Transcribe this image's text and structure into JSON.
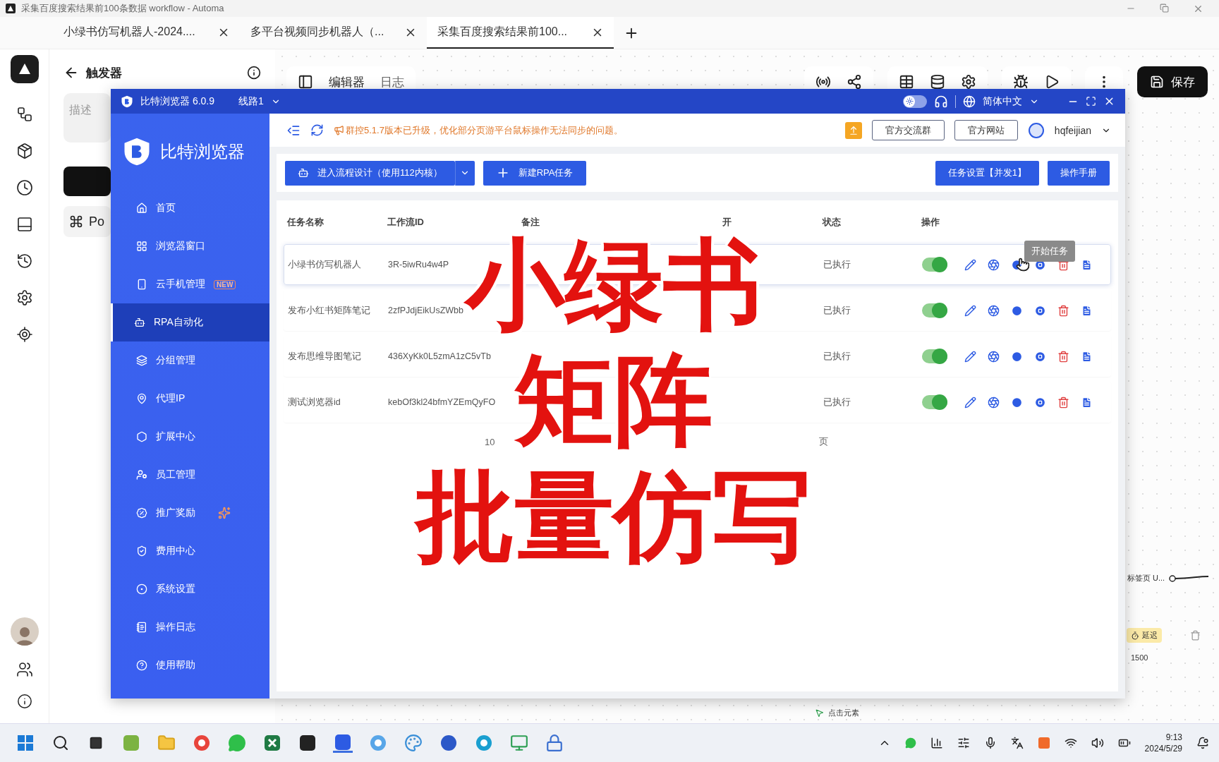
{
  "window": {
    "title": "采集百度搜索结果前100条数据 workflow - Automa"
  },
  "tabs": [
    {
      "label": "小绿书仿写机器人-2024....",
      "selected": false
    },
    {
      "label": "多平台视频同步机器人（...",
      "selected": false
    },
    {
      "label": "采集百度搜索结果前100...",
      "selected": true
    }
  ],
  "editor": {
    "back_label": "触发器",
    "description_placeholder": "描述",
    "side_item": "Po",
    "view_tabs": [
      {
        "label": "编辑器",
        "selected": true
      },
      {
        "label": "日志",
        "selected": false
      }
    ],
    "save_button": "保存"
  },
  "bit_browser": {
    "title": "比特浏览器 6.0.9",
    "route": "线路1",
    "dark_mode": false,
    "language": "简体中文",
    "brand": "比特浏览器",
    "nav": [
      {
        "label": "首页",
        "selected": false
      },
      {
        "label": "浏览器窗口",
        "selected": false
      },
      {
        "label": "云手机管理",
        "badge": "NEW",
        "selected": false
      },
      {
        "label": "RPA自动化",
        "selected": true
      },
      {
        "label": "分组管理",
        "selected": false
      },
      {
        "label": "代理IP",
        "selected": false
      },
      {
        "label": "扩展中心",
        "selected": false
      },
      {
        "label": "员工管理",
        "selected": false
      },
      {
        "label": "推广奖励",
        "selected": false
      },
      {
        "label": "费用中心",
        "selected": false
      },
      {
        "label": "系统设置",
        "selected": false
      },
      {
        "label": "操作日志",
        "selected": false
      },
      {
        "label": "使用帮助",
        "selected": false
      }
    ],
    "notice": "群控5.1.7版本已升级，优化部分页游平台鼠标操作无法同步的问题。",
    "top_buttons": [
      "官方交流群",
      "官方网站"
    ],
    "user": "hqfeijian",
    "actions": {
      "design": "进入流程设计（使用112内核）",
      "new_task": "新建RPA任务",
      "settings": "任务设置【并发1】",
      "manual": "操作手册"
    },
    "table": {
      "columns": [
        "任务名称",
        "工作流ID",
        "备注",
        "开",
        "状态",
        "操作"
      ],
      "rows": [
        {
          "name": "小绿书仿写机器人",
          "workflow_id": "3R-5iwRu4w4P",
          "status": "已执行",
          "enabled": true,
          "selected": true
        },
        {
          "name": "发布小红书矩阵笔记",
          "workflow_id": "2zfPJdjEikUsZWbb",
          "status": "已执行",
          "enabled": true,
          "selected": false
        },
        {
          "name": "发布思维导图笔记",
          "workflow_id": "436XyKk0L5zmA1zC5vTb",
          "status": "已执行",
          "enabled": true,
          "selected": false
        },
        {
          "name": "测试浏览器id",
          "workflow_id": "kebOf3kl24bfmYZEmQyFO",
          "status": "已执行",
          "enabled": true,
          "selected": false
        }
      ]
    },
    "tooltip": "开始任务",
    "pagination": {
      "page_size": "10",
      "suffix": "页"
    }
  },
  "overlay_caption": [
    "小绿书",
    "矩阵",
    "批量仿写"
  ],
  "canvas": {
    "tab_node": "标签页 U...",
    "delay_tag": "延迟",
    "delay_value": "1500",
    "click_node": "点击元素"
  },
  "taskbar": {
    "time": "9:13",
    "date": "2024/5/29"
  }
}
